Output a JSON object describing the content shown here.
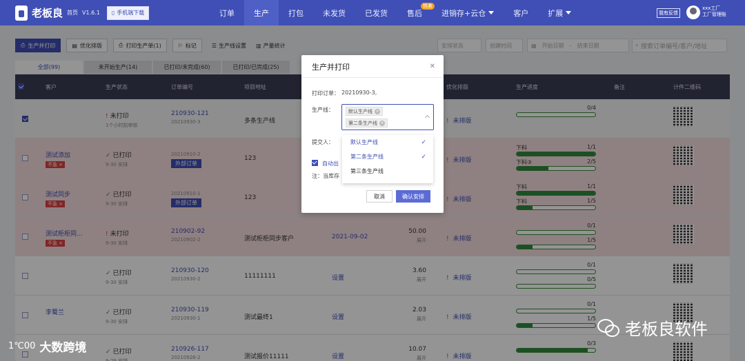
{
  "topbar": {
    "logo_text": "老板良",
    "logo_sub": "首页",
    "version": "V1.6.1",
    "download_label": "手机端下载",
    "nav": [
      {
        "label": "订单"
      },
      {
        "label": "生产",
        "active": true
      },
      {
        "label": "打包"
      },
      {
        "label": "未发货"
      },
      {
        "label": "已发货"
      },
      {
        "label": "售后",
        "badge": "热卖"
      },
      {
        "label": "进销存+云仓",
        "caret": true
      },
      {
        "label": "客户"
      },
      {
        "label": "扩展",
        "caret": true
      }
    ],
    "feedback": "我有反馈",
    "user_line1": "xxx工厂",
    "user_line2": "工厂管理账",
    "accent": "#3f4fb5"
  },
  "toolbar": {
    "produce_print": "生产并打印",
    "optimize": "优化排版",
    "print_sheet": "打印生产单(1)",
    "mark": "标记",
    "line_settings": "生产线设置",
    "output_stats": "产量统计"
  },
  "filters": {
    "schedule_status": "安排状态",
    "created_time": "创建时间",
    "start_date": "开始日期",
    "end_date": "结束日期",
    "search_placeholder": "搜索订单编号/客户/地址"
  },
  "tabs": [
    {
      "label": "全部(99)",
      "active": true
    },
    {
      "label": "未开始生产(14)"
    },
    {
      "label": "已打印/未完成(60)"
    },
    {
      "label": "已打印/已完成(25)"
    }
  ],
  "table": {
    "headers": [
      "客户",
      "生产状态",
      "订单编号",
      "项目地址",
      "优化排版",
      "生产进度",
      "备注",
      "计件二维码"
    ],
    "rows": [
      {
        "checked": true,
        "style": "grey",
        "customer": "",
        "tag": "",
        "status": "未打印",
        "status_type": "warn",
        "status_sub": "1个小时前审核",
        "order": "210930-121",
        "order_sub": "20210930-3",
        "ext": "",
        "project": "多条生产线",
        "schedule": "",
        "area": "",
        "area_sub": "",
        "optimize": "未排版",
        "progress": [
          {
            "label": "",
            "value": "0/4",
            "fraction": 0
          }
        ]
      },
      {
        "checked": false,
        "style": "pink",
        "customer": "测试添加",
        "tag": "不急",
        "status": "已打印",
        "status_type": "ok",
        "status_sub": "9-30 安排",
        "order": "",
        "order_sub": "20210910-2",
        "ext": "外部订单",
        "project": "123",
        "schedule": "",
        "area": "",
        "area_sub": "",
        "optimize": "未排版",
        "progress": [
          {
            "label": "下料",
            "value": "1/1",
            "fraction": 1
          },
          {
            "label": "下料③",
            "value": "2/5",
            "fraction": 0.4
          }
        ]
      },
      {
        "checked": false,
        "style": "pink",
        "customer": "测试同步",
        "tag": "不急",
        "status": "已打印",
        "status_type": "ok",
        "status_sub": "9-30 安排",
        "order": "",
        "order_sub": "20210910-1",
        "ext": "外部订单",
        "project": "123",
        "schedule": "",
        "area": "",
        "area_sub": "",
        "optimize": "未排版",
        "progress": [
          {
            "label": "下料",
            "value": "1/1",
            "fraction": 1
          },
          {
            "label": "下料",
            "value": "1/5",
            "fraction": 0.2
          }
        ]
      },
      {
        "checked": false,
        "style": "pink",
        "customer": "测试柜柜同…",
        "tag": "不急",
        "status": "未打印",
        "status_type": "warn",
        "status_sub": "9-30 安排",
        "order": "210902-92",
        "order_sub": "20210902-2",
        "ext": "",
        "project": "测试柜柜同步客户",
        "schedule": "2021-09-02",
        "area": "50.00",
        "area_sub": "展开",
        "optimize": "未排版",
        "progress": [
          {
            "label": "",
            "value": "0/1",
            "fraction": 0
          },
          {
            "label": "",
            "value": "1/5",
            "fraction": 0.2
          }
        ]
      },
      {
        "checked": false,
        "style": "white",
        "customer": "",
        "tag": "",
        "status": "已打印",
        "status_type": "ok",
        "status_sub": "9-30 安排",
        "order": "210930-120",
        "order_sub": "20210930-2",
        "ext": "",
        "project": "11111111",
        "schedule": "设置",
        "area": "3.60",
        "area_sub": "展开",
        "optimize": "未排版",
        "progress": [
          {
            "label": "",
            "value": "0/1",
            "fraction": 0
          },
          {
            "label": "",
            "value": "0/5",
            "fraction": 0
          }
        ]
      },
      {
        "checked": false,
        "style": "white",
        "customer": "李蜀兰",
        "tag": "",
        "status": "已打印",
        "status_type": "ok",
        "status_sub": "9-30 安排",
        "order": "210930-119",
        "order_sub": "20210930-1",
        "ext": "",
        "project": "测试最终1",
        "schedule": "设置",
        "area": "2.03",
        "area_sub": "展开",
        "optimize": "未排版",
        "progress": [
          {
            "label": "",
            "value": "0/1",
            "fraction": 0
          },
          {
            "label": "",
            "value": "1/5",
            "fraction": 0.2
          }
        ]
      },
      {
        "checked": false,
        "style": "white",
        "customer": "",
        "tag": "",
        "status": "已打印",
        "status_type": "ok",
        "status_sub": "9-29 安排",
        "order": "210926-117",
        "order_sub": "20210926-2",
        "ext": "",
        "project": "测试报价11111",
        "schedule": "设置",
        "area": "10.07",
        "area_sub": "展开",
        "optimize": "未排版",
        "progress": [
          {
            "label": "",
            "value": "0/3",
            "fraction": 0.9
          }
        ]
      }
    ]
  },
  "modal": {
    "title": "生产并打印",
    "print_orders_label": "打印订单：",
    "print_orders_value": "20210930-3,",
    "line_label": "生产线：",
    "chips": [
      "默认生产线",
      "第二条生产线"
    ],
    "submitter_label": "提交人：",
    "auto_label": "自动出",
    "note_label": "注：当库存",
    "cancel": "取消",
    "confirm": "确认安排"
  },
  "dropdown": [
    {
      "label": "默认生产线",
      "selected": true
    },
    {
      "label": "第二条生产线",
      "selected": true
    },
    {
      "label": "第三条生产线",
      "selected": false
    }
  ],
  "watermarks": {
    "left_logo": "1℃00",
    "left": "大数跨境",
    "right": "老板良软件"
  }
}
